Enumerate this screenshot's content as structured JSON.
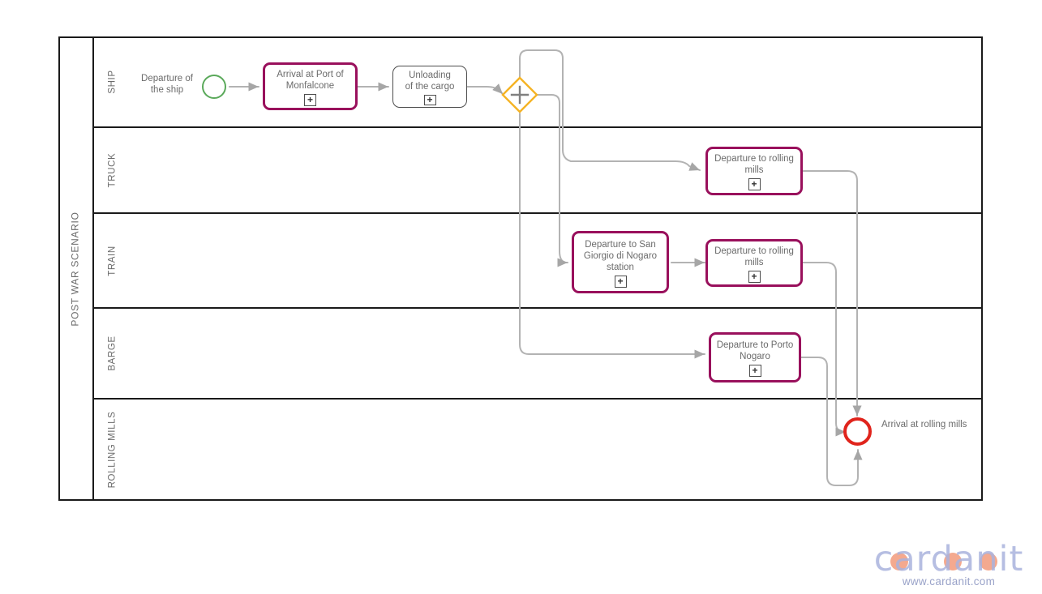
{
  "diagram": {
    "type": "bpmn-collaboration",
    "pool": {
      "name": "POST WAR SCENARIO"
    },
    "lanes": [
      {
        "id": "ship",
        "name": "SHIP"
      },
      {
        "id": "truck",
        "name": "TRUCK"
      },
      {
        "id": "train",
        "name": "TRAIN"
      },
      {
        "id": "barge",
        "name": "BARGE"
      },
      {
        "id": "rolling_mills",
        "name": "ROLLING\nMILLS"
      }
    ],
    "events": [
      {
        "id": "start_ship",
        "lane": "ship",
        "kind": "start-event",
        "label": "Departure of\nthe ship",
        "color": "#5aa95a"
      },
      {
        "id": "end_rolling_mills",
        "lane": "rolling_mills",
        "kind": "end-event",
        "label": "Arrival at rolling mills",
        "color": "#e0241c"
      }
    ],
    "gateways": [
      {
        "id": "parallel_split",
        "lane": "ship",
        "kind": "parallel-gateway",
        "marker": "+",
        "color": "#f5b324"
      }
    ],
    "tasks": [
      {
        "id": "arrival_monfalcone",
        "lane": "ship",
        "label": "Arrival at Port of\nMonfalcone",
        "style": "accent",
        "marker": "+",
        "border_color": "#99105c"
      },
      {
        "id": "unloading_cargo",
        "lane": "ship",
        "label": "Unloading\nof the cargo",
        "style": "plain",
        "marker": "+",
        "border_color": "#4d4d4d"
      },
      {
        "id": "truck_to_rolling_mills",
        "lane": "truck",
        "label": "Departure to rolling\nmills",
        "style": "accent",
        "marker": "+",
        "border_color": "#99105c"
      },
      {
        "id": "train_to_san_giorgio",
        "lane": "train",
        "label": "Departure to San\nGiorgio di Nogaro\nstation",
        "style": "accent",
        "marker": "+",
        "border_color": "#99105c"
      },
      {
        "id": "train_to_rolling_mills",
        "lane": "train",
        "label": "Departure to rolling\nmills",
        "style": "accent",
        "marker": "+",
        "border_color": "#99105c"
      },
      {
        "id": "barge_to_porto_nogaro",
        "lane": "barge",
        "label": "Departure to Porto\nNogaro",
        "style": "accent",
        "marker": "+",
        "border_color": "#99105c"
      }
    ],
    "flow_color": "#b3b3b3"
  },
  "brand": {
    "name": "cardanit",
    "url": "www.cardanit.com",
    "text_color": "#a9b3dd",
    "dot_color": "#f4a98f"
  }
}
